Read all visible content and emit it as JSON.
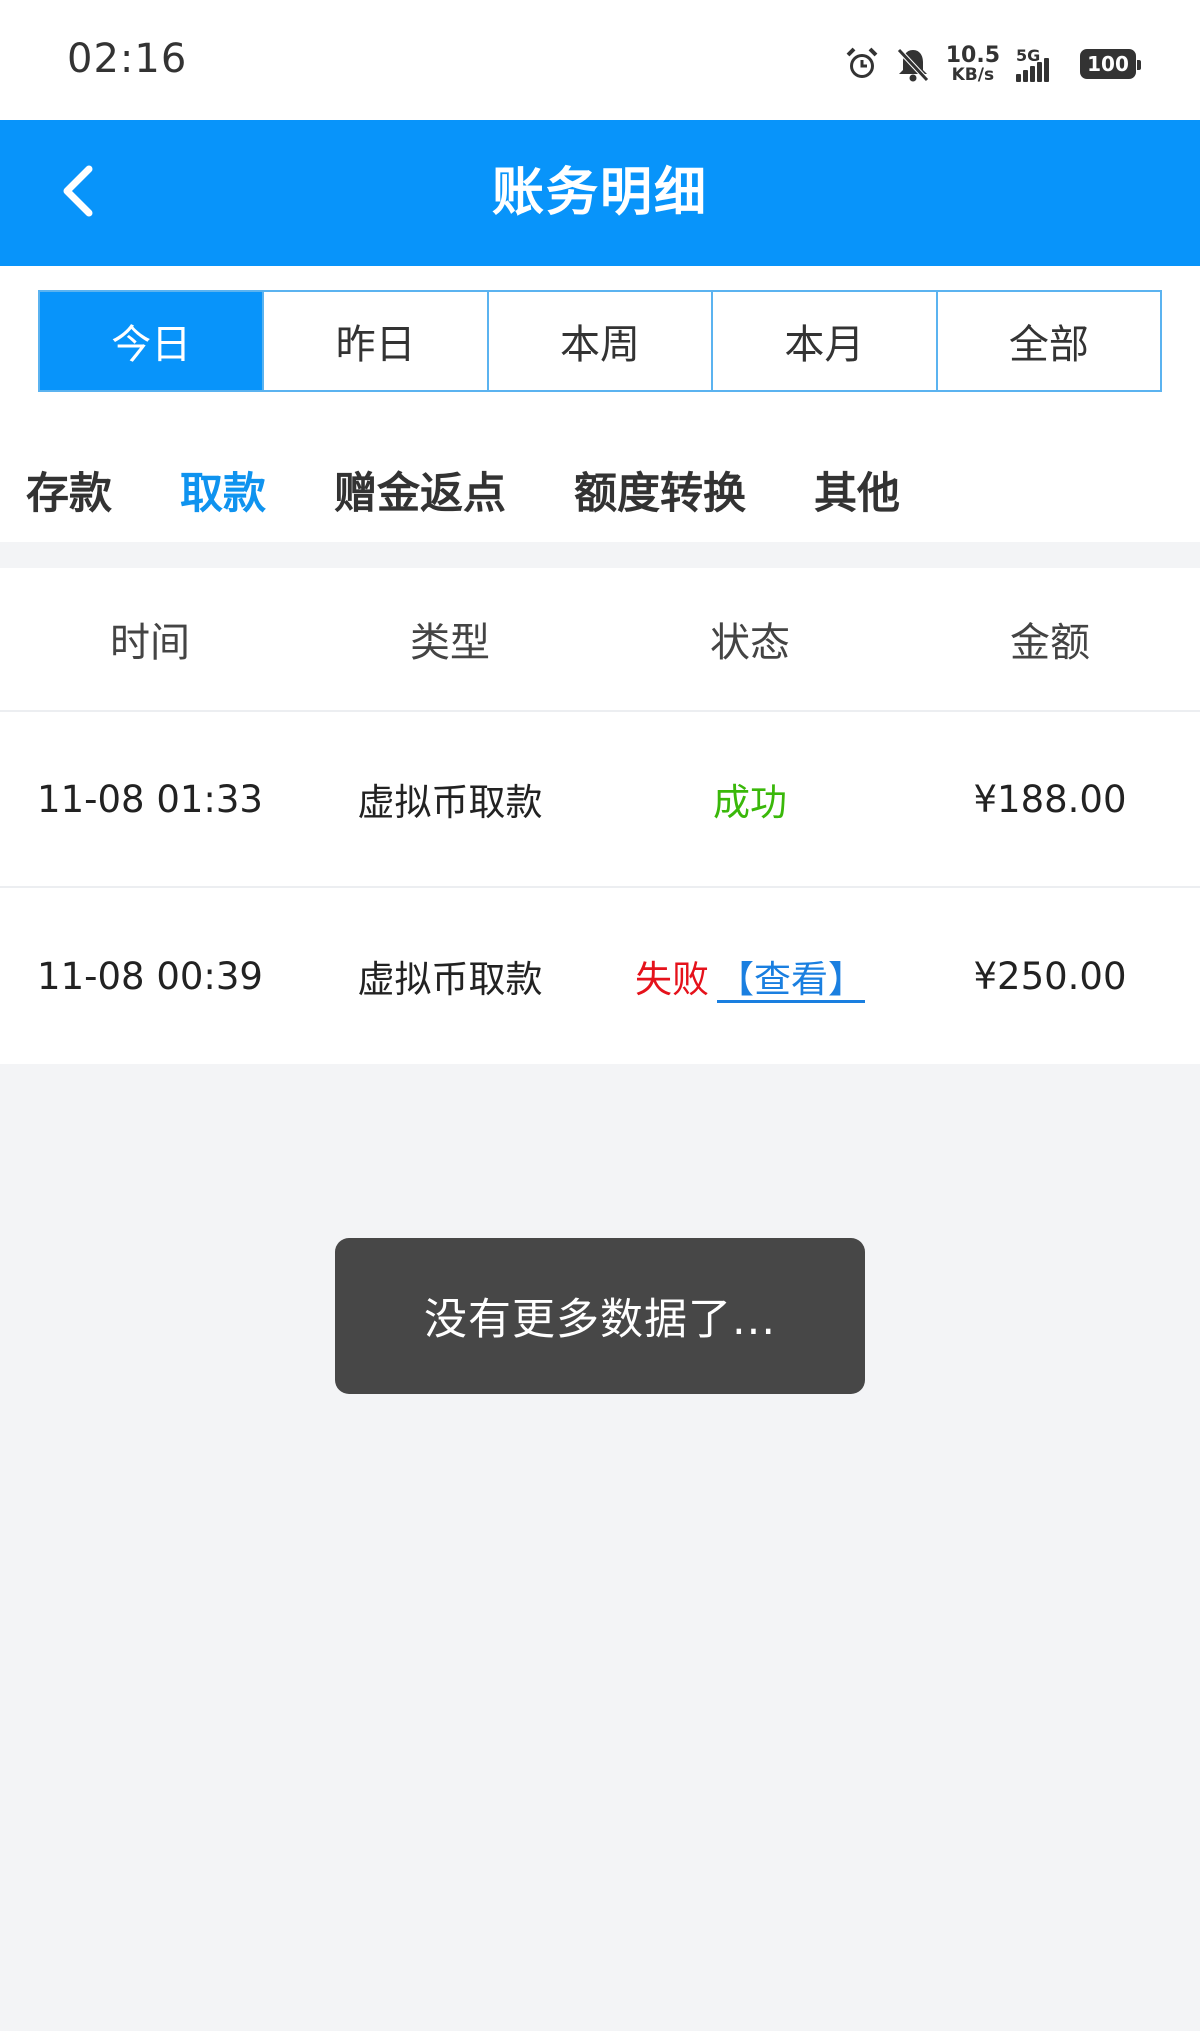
{
  "status_bar": {
    "time": "02:16",
    "net_speed_value": "10.5",
    "net_speed_unit": "KB/s",
    "network": "5G",
    "battery": "100"
  },
  "header": {
    "title": "账务明细"
  },
  "date_tabs": [
    {
      "label": "今日",
      "active": true
    },
    {
      "label": "昨日",
      "active": false
    },
    {
      "label": "本周",
      "active": false
    },
    {
      "label": "本月",
      "active": false
    },
    {
      "label": "全部",
      "active": false
    }
  ],
  "category_tabs": [
    {
      "label": "存款",
      "active": false
    },
    {
      "label": "取款",
      "active": true
    },
    {
      "label": "赠金返点",
      "active": false
    },
    {
      "label": "额度转换",
      "active": false
    },
    {
      "label": "其他",
      "active": false
    }
  ],
  "table": {
    "headers": [
      "时间",
      "类型",
      "状态",
      "金额"
    ],
    "rows": [
      {
        "time": "11-08 01:33",
        "type": "虚拟币取款",
        "status": "成功",
        "link": "",
        "amount": "¥188.00"
      },
      {
        "time": "11-08 00:39",
        "type": "虚拟币取款",
        "status": "失败",
        "link": "【查看】",
        "amount": "¥250.00"
      }
    ]
  },
  "toast": {
    "message": "没有更多数据了..."
  },
  "colors": {
    "brand": "#0894fa",
    "success": "#3ab80a",
    "fail": "#e5121b",
    "link": "#1a7fe0"
  },
  "icons": [
    "alarm-icon",
    "bell-muted-icon",
    "signal-icon",
    "battery-icon",
    "back-arrow-icon"
  ]
}
